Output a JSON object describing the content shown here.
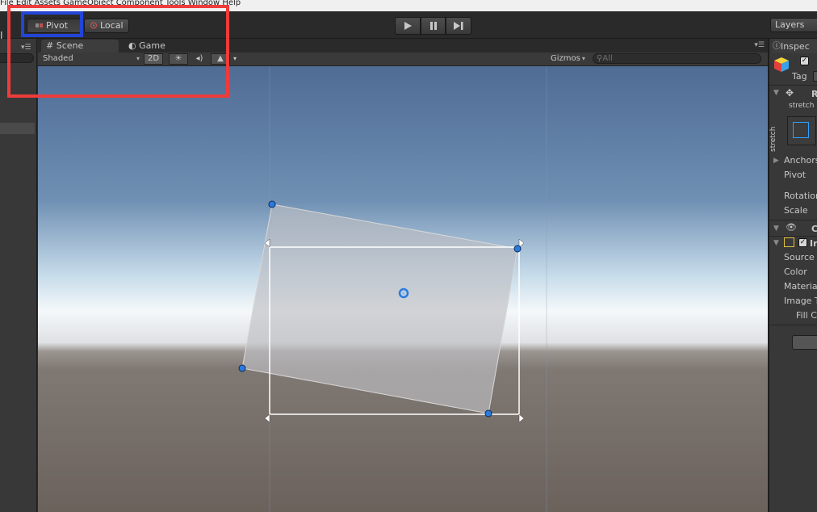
{
  "menubar": {
    "text": "File  Edit  Assets  GameObject  Component  Tools  Window  Help"
  },
  "toolbar": {
    "pivot_label": "Pivot",
    "local_label": "Local",
    "layers_label": "Layers",
    "play_icons": [
      "play-icon",
      "pause-icon",
      "step-icon"
    ]
  },
  "tabs": {
    "scene": "Scene",
    "game": "Game"
  },
  "scene_toolbar": {
    "shading_mode": "Shaded",
    "mode_2d": "2D",
    "gizmos": "Gizmos",
    "search_placeholder": "All"
  },
  "inspector": {
    "tab_label": "Inspec",
    "tag_label": "Tag",
    "rect_transform_title": "R",
    "stretch_h": "stretch",
    "stretch_v": "stretch",
    "rows": {
      "anchors": "Anchors",
      "pivot": "Pivot",
      "rotation": "Rotation",
      "scale": "Scale",
      "canvas_renderer": "C",
      "image": "Ir",
      "source": "Source",
      "color": "Color",
      "material": "Materia",
      "image_type": "Image T",
      "fill": "Fill C"
    }
  },
  "colors": {
    "highlight_red": "#ee3b3b",
    "highlight_blue": "#2345d6",
    "handle_blue": "#2a7be0"
  }
}
